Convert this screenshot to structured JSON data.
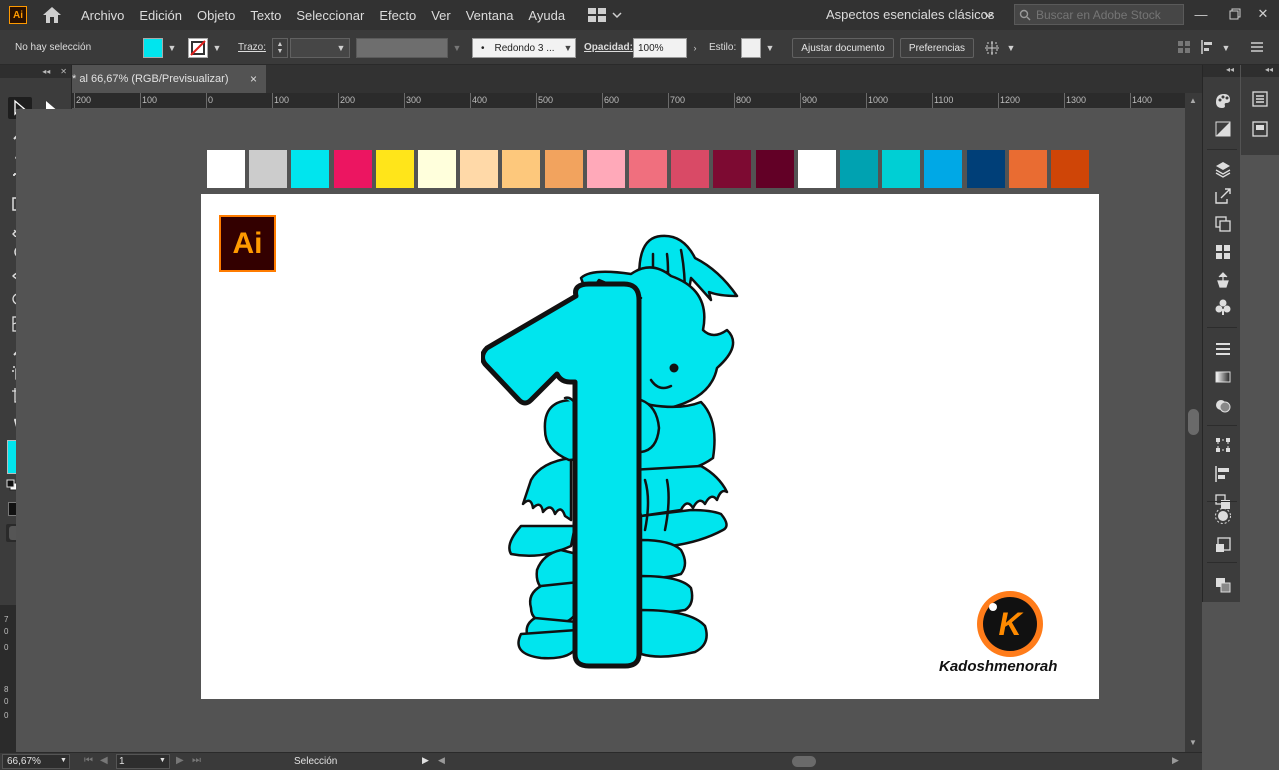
{
  "app": {
    "logo_text": "Ai"
  },
  "menu": [
    "Archivo",
    "Edición",
    "Objeto",
    "Texto",
    "Seleccionar",
    "Efecto",
    "Ver",
    "Ventana",
    "Ayuda"
  ],
  "workspace": {
    "name": "Aspectos esenciales clásicos"
  },
  "search": {
    "placeholder": "Buscar en Adobe Stock"
  },
  "control_bar": {
    "selection_status": "No hay selección",
    "fill_color": "#00e5ee",
    "stroke_label": "Trazo:",
    "brush_label": "Redondo 3 ...",
    "brush_dot": "•",
    "opacity_label": "Opacidad:",
    "opacity_value": "100%",
    "style_label": "Estilo:",
    "adjust_document": "Ajustar documento",
    "preferences": "Preferencias"
  },
  "document": {
    "tab_title": "* al 66,67% (RGB/Previsualizar)",
    "close": "×"
  },
  "ruler": {
    "h_ticks": [
      "200",
      "100",
      "0",
      "100",
      "200",
      "300",
      "400",
      "500",
      "600",
      "700",
      "800",
      "900",
      "1000",
      "1100",
      "1200",
      "1300",
      "1400"
    ],
    "v_ticks": [
      "7",
      "0",
      "0",
      "8",
      "0",
      "0"
    ]
  },
  "swatches": [
    "#ffffff",
    "#cccccc",
    "#00e5ee",
    "#ec1561",
    "#ffe51a",
    "#ffffdc",
    "#ffd9a8",
    "#fdc87c",
    "#f2a35e",
    "#ffa9b9",
    "#f06f7e",
    "#d94a66",
    "#7d0a32",
    "#620026",
    "#ffffff",
    "#00a2b1",
    "#00cfd4",
    "#00a8e6",
    "#003f78",
    "#e96c32",
    "#cf4507"
  ],
  "artwork": {
    "ai_badge": "Ai",
    "brand_initial": "K",
    "brand_name": "Kadoshmenorah",
    "cyan": "#00e5ee"
  },
  "status_bar": {
    "zoom": "66,67%",
    "artboard_number": "1",
    "tool_name": "Selección"
  }
}
